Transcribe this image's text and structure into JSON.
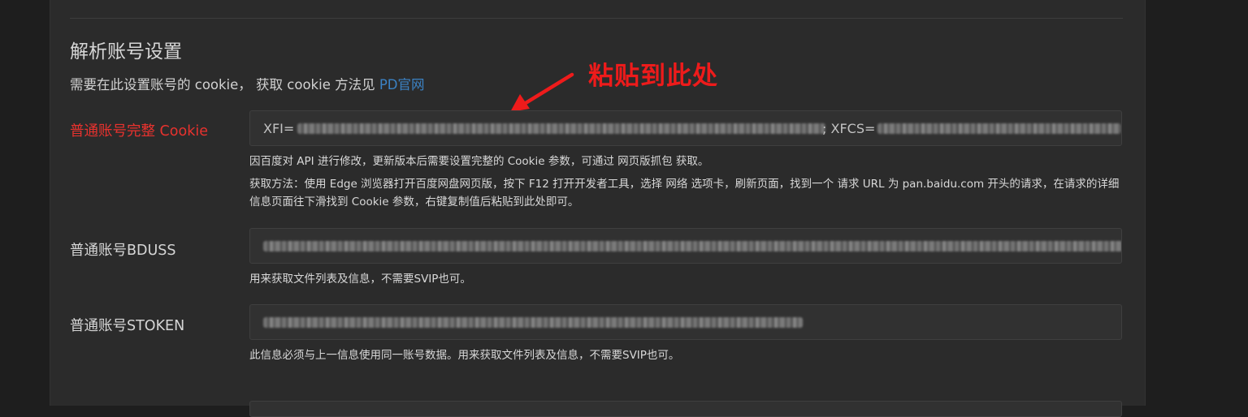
{
  "section": {
    "title": "解析账号设置",
    "description_prefix": "需要在此设置账号的 cookie， 获取 cookie 方法见 ",
    "description_link": "PD官网"
  },
  "annotation": {
    "text": "粘贴到此处",
    "color": "#ee1b1b"
  },
  "fields": {
    "cookie": {
      "label": "普通账号完整 Cookie",
      "label_color": "#e8322e",
      "value_prefix_1": "XFI=",
      "value_prefix_2": "; XFCS=",
      "help_1": "因百度对 API 进行修改，更新版本后需要设置完整的 Cookie 参数，可通过 网页版抓包 获取。",
      "help_2": "获取方法：使用 Edge 浏览器打开百度网盘网页版，按下 F12 打开开发者工具，选择 网络 选项卡，刷新页面，找到一个 请求 URL 为 pan.baidu.com 开头的请求，在请求的详细信息页面往下滑找到 Cookie 参数，右键复制值后粘贴到此处即可。"
    },
    "bduss": {
      "label": "普通账号BDUSS",
      "help": "用来获取文件列表及信息，不需要SVIP也可。"
    },
    "stoken": {
      "label": "普通账号STOKEN",
      "help": "此信息必须与上一信息使用同一账号数据。用来获取文件列表及信息，不需要SVIP也可。"
    }
  },
  "colors": {
    "background": "#1e1e1e",
    "panel": "#2b2b2b",
    "link": "#3b82c4"
  }
}
